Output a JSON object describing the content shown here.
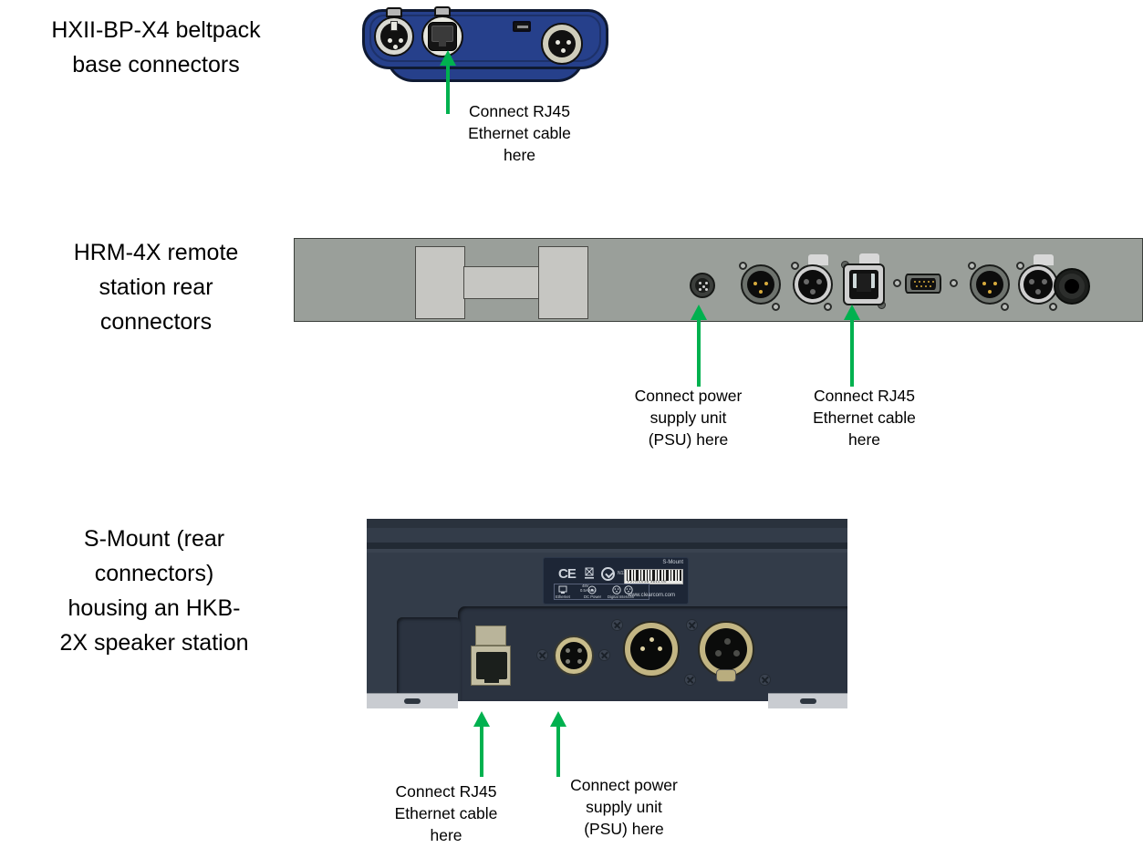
{
  "page": {
    "kind": "device-rear-connector-diagram",
    "background": "#ffffff",
    "arrow_color": "#00b14f"
  },
  "sections": [
    {
      "id": "beltpack",
      "title": "HXII-BP-X4 beltpack\nbase connectors",
      "device_color": "#26408b",
      "connectors": [
        "xlr-female-3pin",
        "rj45-ethercon",
        "usb-port",
        "xlr-male-3pin"
      ],
      "callouts": [
        {
          "id": "beltpack-rj45",
          "text": "Connect RJ45\nEthernet cable\nhere"
        }
      ]
    },
    {
      "id": "hrm4x",
      "title": "HRM-4X remote\nstation rear\nconnectors",
      "device_color": "#9a9f9a",
      "connectors": [
        "din-4pin-power",
        "xlr-male-3pin",
        "xlr-female-3pin",
        "rj45-neutrik",
        "db9-serial",
        "xlr-male-3pin",
        "xlr-female-3pin",
        "quarter-inch-jack"
      ],
      "callouts": [
        {
          "id": "hrm-psu",
          "text": "Connect power\nsupply unit\n(PSU) here"
        },
        {
          "id": "hrm-rj45",
          "text": "Connect RJ45\nEthernet cable\nhere"
        }
      ]
    },
    {
      "id": "smount",
      "title": "S-Mount (rear\nconnectors)\nhousing an HKB-\n2X speaker station",
      "device_color": "#333c49",
      "connectors": [
        "rj45-ethernet",
        "din-4pin-power",
        "xlr-male-3pin",
        "xlr-female-3pin"
      ],
      "label_plate": {
        "product": "S-Mount",
        "url": "www.clearcom.com",
        "barcode_number": "F27RC018  3611-00",
        "ce_mark": "CE",
        "ctick_code": "N136",
        "voltage": "48V",
        "current": "0.5A Max",
        "port_labels": [
          "Ethernet",
          "DC Power",
          "Digital Intercom"
        ]
      },
      "callouts": [
        {
          "id": "smount-rj45",
          "text": "Connect RJ45\nEthernet cable\nhere"
        },
        {
          "id": "smount-psu",
          "text": "Connect power\nsupply unit\n(PSU) here"
        }
      ]
    }
  ]
}
